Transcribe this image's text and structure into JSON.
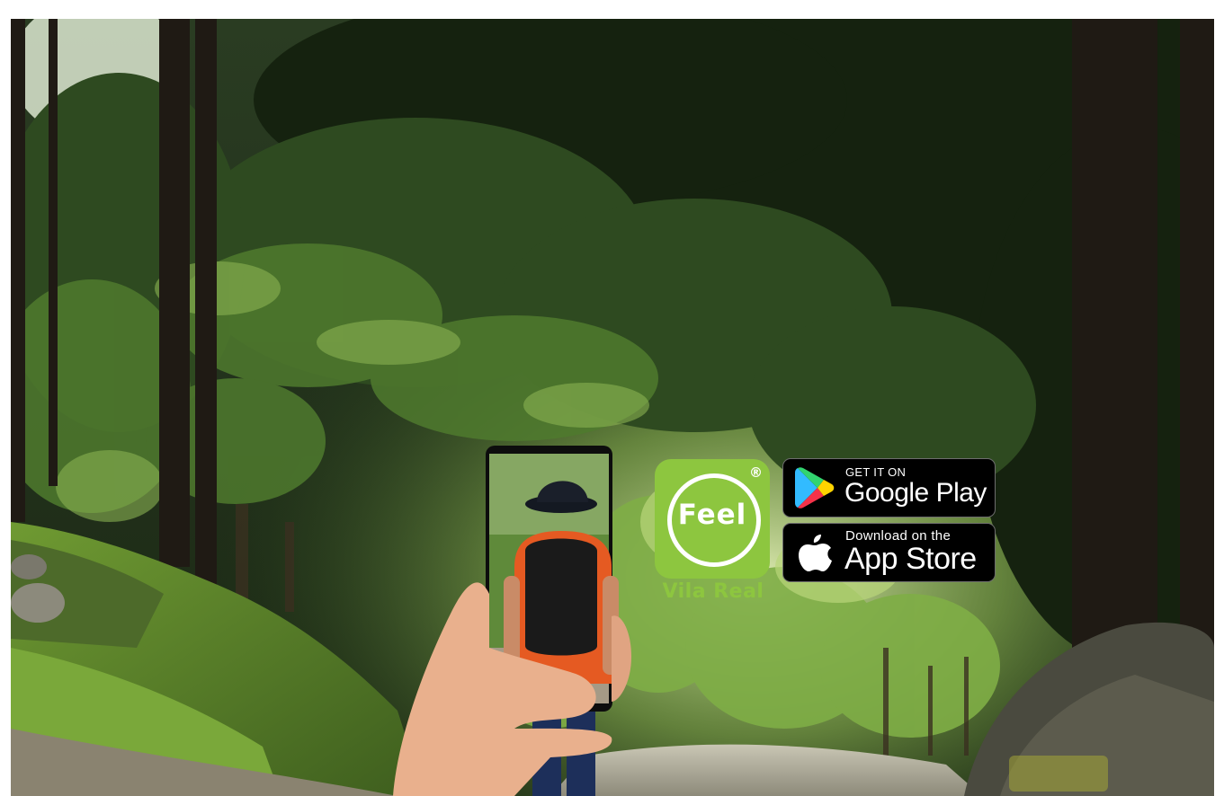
{
  "brand": {
    "logo_text": "Feel",
    "registered_mark": "®",
    "city": "Vila Real",
    "color": "#8dc63f"
  },
  "badges": {
    "google_play": {
      "top_line": "GET IT ON",
      "store_name": "Google Play",
      "icon": "google-play-icon"
    },
    "app_store": {
      "top_line": "Download on the",
      "store_name": "App Store",
      "icon": "apple-icon"
    }
  }
}
